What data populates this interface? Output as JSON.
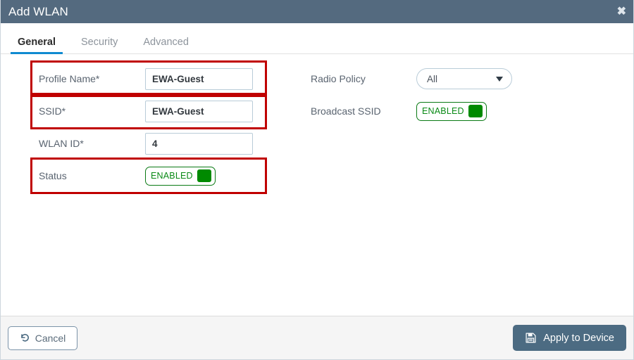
{
  "window": {
    "title": "Add WLAN",
    "close_icon": "close-icon"
  },
  "tabs": [
    {
      "label": "General",
      "active": true
    },
    {
      "label": "Security",
      "active": false
    },
    {
      "label": "Advanced",
      "active": false
    }
  ],
  "form": {
    "left_column": [
      {
        "label": "Profile Name*",
        "type": "text",
        "value": "EWA-Guest",
        "highlighted": true
      },
      {
        "label": "SSID*",
        "type": "text",
        "value": "EWA-Guest",
        "highlighted": true
      },
      {
        "label": "WLAN ID*",
        "type": "text",
        "value": "4",
        "highlighted": false
      },
      {
        "label": "Status",
        "type": "toggle",
        "value": "ENABLED",
        "highlighted": true
      }
    ],
    "right_column": [
      {
        "label": "Radio Policy",
        "type": "select",
        "value": "All",
        "highlighted": false
      },
      {
        "label": "Broadcast SSID",
        "type": "toggle",
        "value": "ENABLED",
        "highlighted": false
      }
    ]
  },
  "footer": {
    "cancel_label": "Cancel",
    "apply_label": "Apply to Device",
    "cancel_icon": "undo-icon",
    "apply_icon": "save-disk-icon"
  },
  "colors": {
    "header_bg": "#546a7f",
    "accent_tab": "#0f8ad0",
    "annotation": "#c00000",
    "toggle_green": "#008a00",
    "apply_bg": "#4c6b82"
  }
}
